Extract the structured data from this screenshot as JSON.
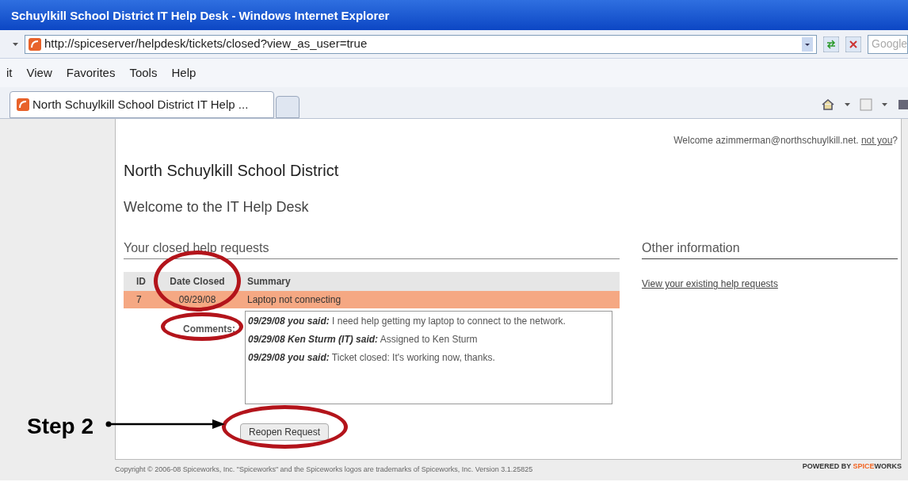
{
  "window": {
    "title": "Schuylkill School District IT Help Desk - Windows Internet Explorer"
  },
  "address_bar": {
    "url": "http://spiceserver/helpdesk/tickets/closed?view_as_user=true",
    "search_placeholder": "Google"
  },
  "menu": [
    "it",
    "View",
    "Favorites",
    "Tools",
    "Help"
  ],
  "tabs": [
    {
      "label": "North Schuylkill School District IT Help ...",
      "selected": true
    }
  ],
  "page": {
    "welcome": "Welcome azimmerman@northschuylkill.net.",
    "not_you": "not you",
    "not_you_suffix": "?",
    "org": "North Schuylkill School District",
    "heading": "Welcome to the IT Help Desk",
    "section": "Your closed help requests",
    "table": {
      "columns": [
        "ID",
        "Date Closed",
        "Summary"
      ],
      "rows": [
        {
          "cells": [
            "7",
            "09/29/08",
            "Laptop not connecting"
          ],
          "selected": true
        }
      ]
    },
    "comments_label": "Comments:",
    "comments": [
      {
        "author": "09/29/08 you said:",
        "text": "I need help getting my laptop to connect to the network."
      },
      {
        "author": "09/29/08 Ken Sturm (IT) said:",
        "text": "Assigned to Ken Sturm"
      },
      {
        "author": "09/29/08 you said:",
        "text": "Ticket closed: It's working now, thanks."
      }
    ],
    "button": "Reopen Request",
    "side_heading": "Other information",
    "side_link": "View your existing help requests"
  },
  "footer": {
    "copyright": "Copyright © 2006-08 Spiceworks, Inc. \"Spiceworks\" and the Spiceworks logos are trademarks of Spiceworks, Inc. Version 3.1.25825",
    "powered": "POWERED BY",
    "brand_a": "SPICE",
    "brand_b": "WORKS"
  },
  "callout": {
    "label": "Step 2"
  }
}
